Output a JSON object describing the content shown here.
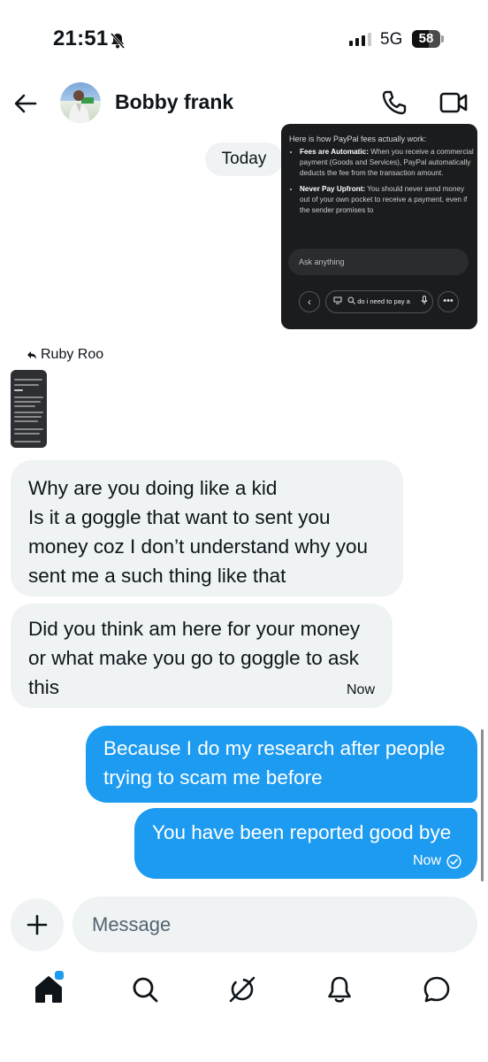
{
  "status_bar": {
    "time": "21:51",
    "network": "5G",
    "battery": "58",
    "battery_level": 0.58
  },
  "header": {
    "contact_name": "Bobby frank"
  },
  "date_chip": "Today",
  "shared_screenshot": {
    "intro": "Here is how PayPal fees actually work:",
    "bullets": [
      {
        "title": "Fees are Automatic:",
        "text": " When you receive a commercial payment (Goods and Services), PayPal automatically deducts the fee from the transaction amount."
      },
      {
        "title": "Never Pay Upfront:",
        "text": " You should never send money out of your own pocket to receive a payment, even if the sender promises to"
      }
    ],
    "input_placeholder": "Ask anything",
    "query_text": "do i need to pay a",
    "back_glyph": "‹",
    "more_glyph": "•••"
  },
  "reply_to": {
    "label": "Ruby Roo"
  },
  "messages": [
    {
      "direction": "in",
      "text": "Why are you doing like a kid\nIs it a goggle that want to sent you money coz I don’t understand why you sent me a such thing like that"
    },
    {
      "direction": "in",
      "text": "Did you think am here for your money or what make you go to goggle to ask this",
      "time": "Now"
    },
    {
      "direction": "out",
      "text": "Because I do my research after people trying to scam me before"
    },
    {
      "direction": "out",
      "text": "You have been reported good bye",
      "time": "Now",
      "status": "read"
    }
  ],
  "composer": {
    "placeholder": "Message",
    "value": ""
  },
  "tabs": [
    {
      "icon": "home-icon",
      "active": true,
      "notification_dot": true
    },
    {
      "icon": "search-icon"
    },
    {
      "icon": "grok-icon"
    },
    {
      "icon": "bell-icon"
    },
    {
      "icon": "messages-icon"
    }
  ],
  "colors": {
    "accent": "#1d9bf0",
    "incoming_bubble": "#eff3f4",
    "text": "#0f1419"
  }
}
